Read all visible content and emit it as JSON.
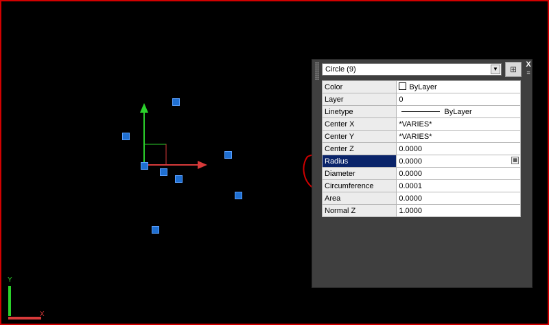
{
  "canvas": {
    "background": "#000000",
    "frame_color": "#d10000",
    "grip_color": "#1f6fd1",
    "ucs_icon": {
      "y_label": "Y",
      "x_label": "X"
    }
  },
  "properties_palette": {
    "selection_label": "Circle (9)",
    "dropdown_icon": "chevron-down-icon",
    "quick_select_icon": "quick-select-icon",
    "close_label": "X",
    "menu_icon": "≡",
    "rows": [
      {
        "name": "Color",
        "value": "ByLayer"
      },
      {
        "name": "Layer",
        "value": "0"
      },
      {
        "name": "Linetype",
        "value": "ByLayer"
      },
      {
        "name": "Center X",
        "value": "*VARIES*"
      },
      {
        "name": "Center Y",
        "value": "*VARIES*"
      },
      {
        "name": "Center Z",
        "value": "0.0000"
      },
      {
        "name": "Radius",
        "value": "0.0000"
      },
      {
        "name": "Diameter",
        "value": "0.0000"
      },
      {
        "name": "Circumference",
        "value": "0.0001"
      },
      {
        "name": "Area",
        "value": "0.0000"
      },
      {
        "name": "Normal Z",
        "value": "1.0000"
      }
    ],
    "highlight_color": "#0a246a",
    "annotation_color": "#d10000"
  }
}
